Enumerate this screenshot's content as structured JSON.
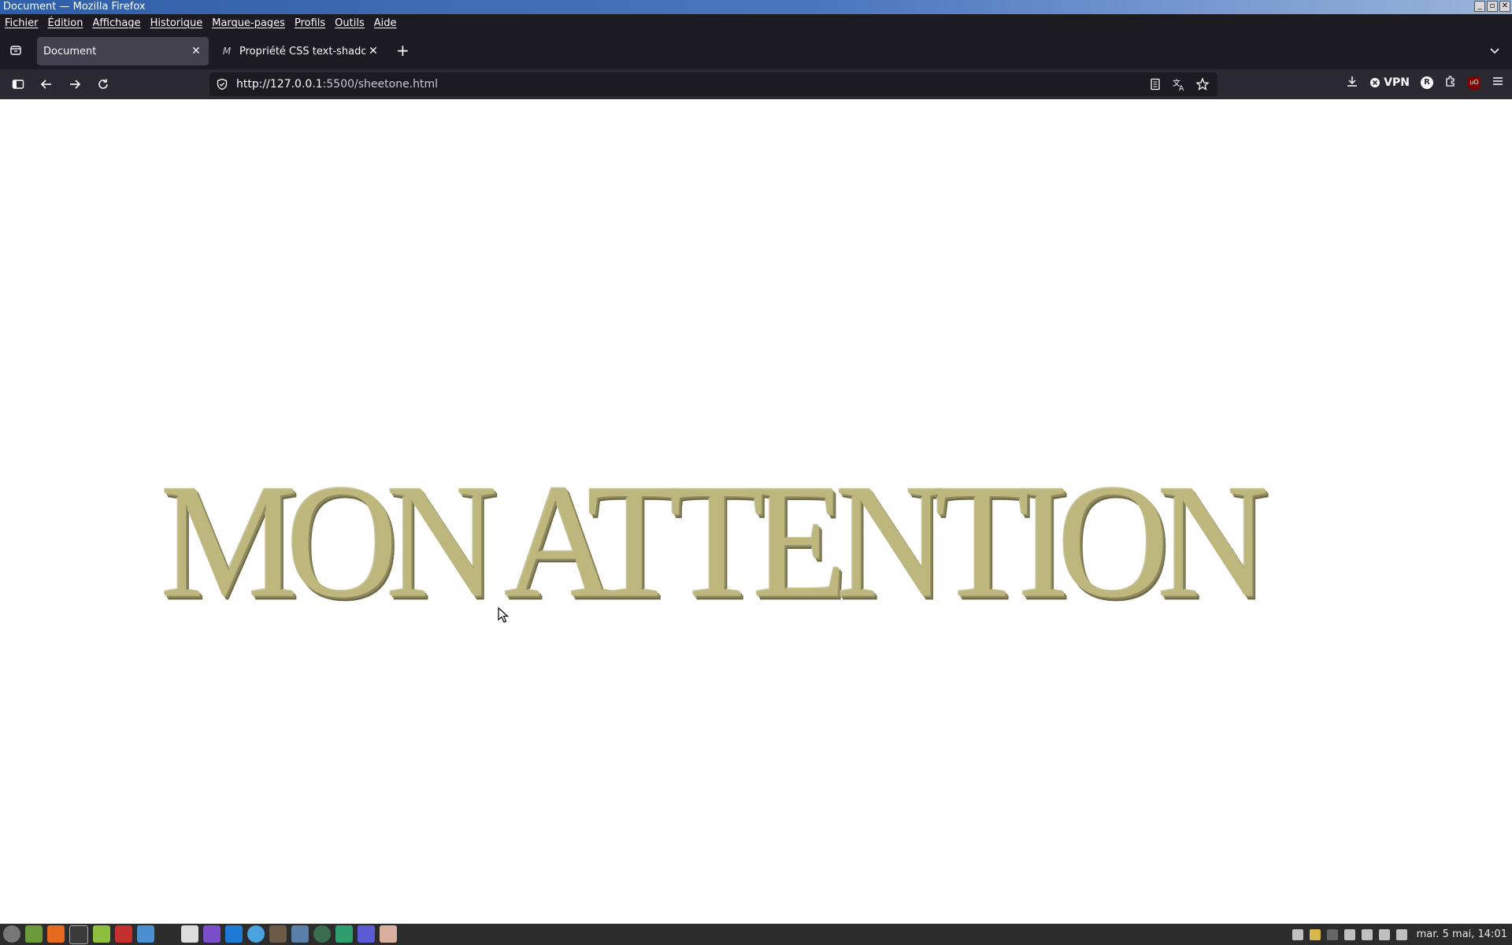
{
  "window": {
    "title": "Document — Mozilla Firefox"
  },
  "menubar": {
    "items": [
      "Fichier",
      "Édition",
      "Affichage",
      "Historique",
      "Marque-pages",
      "Profils",
      "Outils",
      "Aide"
    ]
  },
  "tabs": [
    {
      "label": "Document",
      "active": true
    },
    {
      "label": "Propriété CSS text-shadow",
      "favicon": "M",
      "active": false
    }
  ],
  "navbar": {
    "url_host": "http://127.0.0.1",
    "url_rest": ":5500/sheetone.html",
    "vpn_label": "VPN",
    "profile_initial": "R",
    "ublock_label": "uO"
  },
  "page": {
    "headline": "MON ATTENTION",
    "colors": {
      "text": "#bdb67d",
      "shadow": "#6f6a48"
    }
  },
  "taskbar": {
    "clock": "mar. 5 mai, 14:01"
  },
  "icons": {
    "window": [
      "minimize-icon",
      "maximize-icon",
      "close-icon"
    ],
    "tabs": [
      "tab-overview-icon",
      "close-icon",
      "plus-icon",
      "chevron-down-icon"
    ],
    "nav": [
      "sidebar-icon",
      "back-arrow-icon",
      "forward-arrow-icon",
      "reload-icon",
      "shield-icon",
      "reader-view-icon",
      "translate-icon",
      "star-icon",
      "download-icon",
      "extensions-icon",
      "hamburger-menu-icon"
    ]
  }
}
